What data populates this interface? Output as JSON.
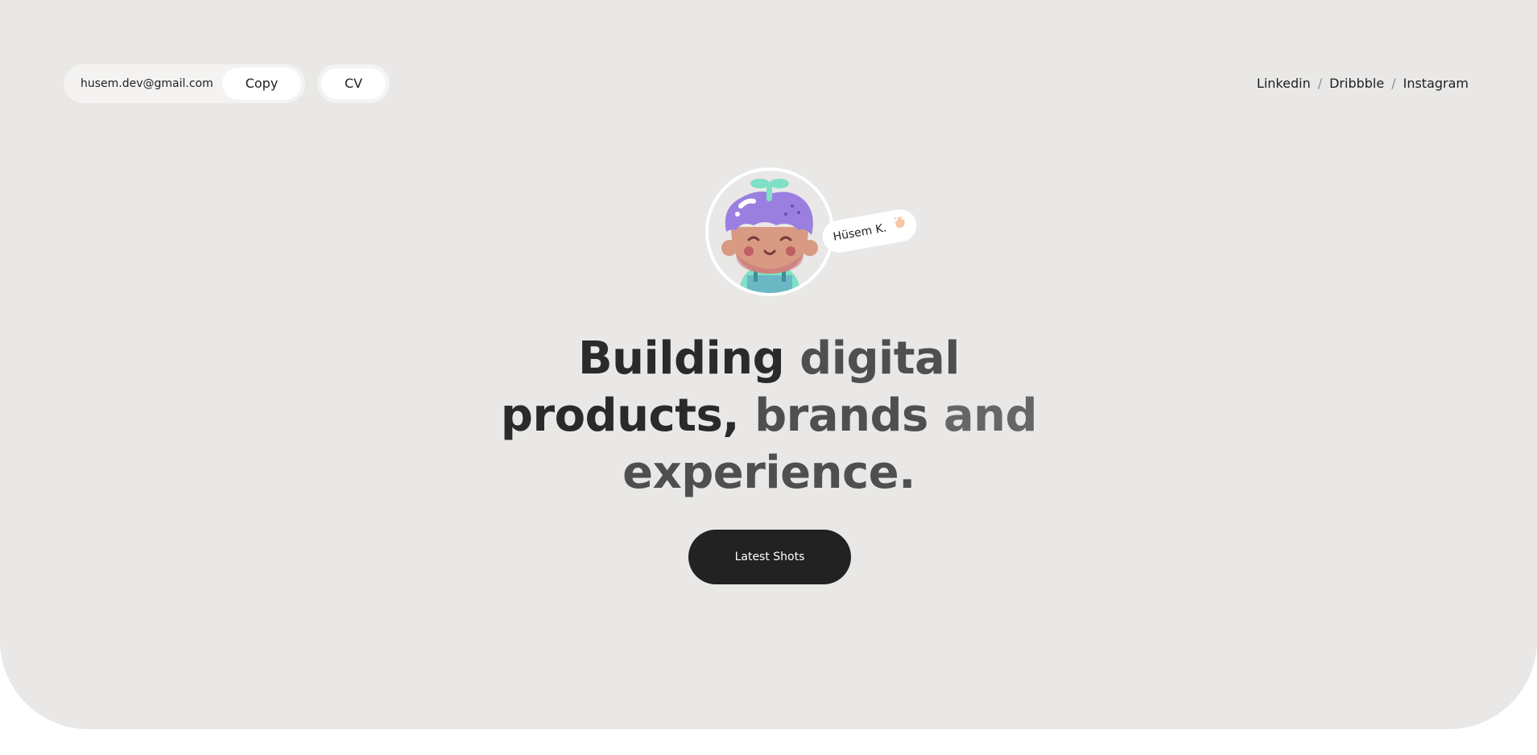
{
  "header": {
    "email": "husem.dev@gmail.com",
    "copy_label": "Copy",
    "cv_label": "CV",
    "links": [
      {
        "label": "Linkedin"
      },
      {
        "label": "Dribbble"
      },
      {
        "label": "Instagram"
      }
    ],
    "separator": "/"
  },
  "profile": {
    "name_tag": "Hüsem K.",
    "wave_icon": "waving-hand-icon",
    "avatar_icon": "cartoon-avatar-icon"
  },
  "hero": {
    "headline_parts": [
      "Building ",
      "digital",
      "products, ",
      "brands ",
      "and",
      "experience."
    ],
    "cta_label": "Latest Shots"
  },
  "colors": {
    "background": "#e9e8e6",
    "pill": "#f4f3f2",
    "cta": "#222222",
    "text_dark": "#2a2a2a",
    "text_mid": "#4f4f4f",
    "text_light": "#666666"
  }
}
